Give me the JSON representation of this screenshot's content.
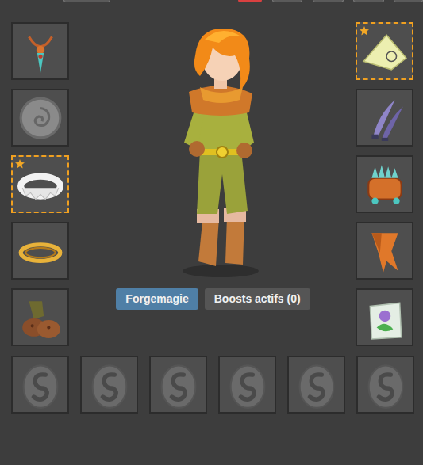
{
  "top_tabs": [
    {
      "selected": false
    },
    {
      "selected": true
    },
    {
      "selected": false
    },
    {
      "selected": false
    },
    {
      "selected": false
    },
    {
      "selected": false
    }
  ],
  "left_slots": [
    {
      "kind": "amulet",
      "starred": false
    },
    {
      "kind": "shield",
      "starred": false
    },
    {
      "kind": "ring",
      "starred": true
    },
    {
      "kind": "belt",
      "starred": false
    },
    {
      "kind": "boots",
      "starred": false
    }
  ],
  "right_slots": [
    {
      "kind": "hat",
      "starred": true
    },
    {
      "kind": "daggers",
      "starred": false
    },
    {
      "kind": "pet",
      "starred": false
    },
    {
      "kind": "cape",
      "starred": false
    },
    {
      "kind": "bag",
      "starred": false
    }
  ],
  "buttons": [
    {
      "label": "Forgemagie",
      "selected": true
    },
    {
      "label": "Boosts actifs (0)",
      "selected": false
    }
  ],
  "pet_slots": [
    {
      "kind": "egg"
    },
    {
      "kind": "egg"
    },
    {
      "kind": "egg"
    },
    {
      "kind": "egg"
    },
    {
      "kind": "egg"
    },
    {
      "kind": "egg"
    }
  ]
}
